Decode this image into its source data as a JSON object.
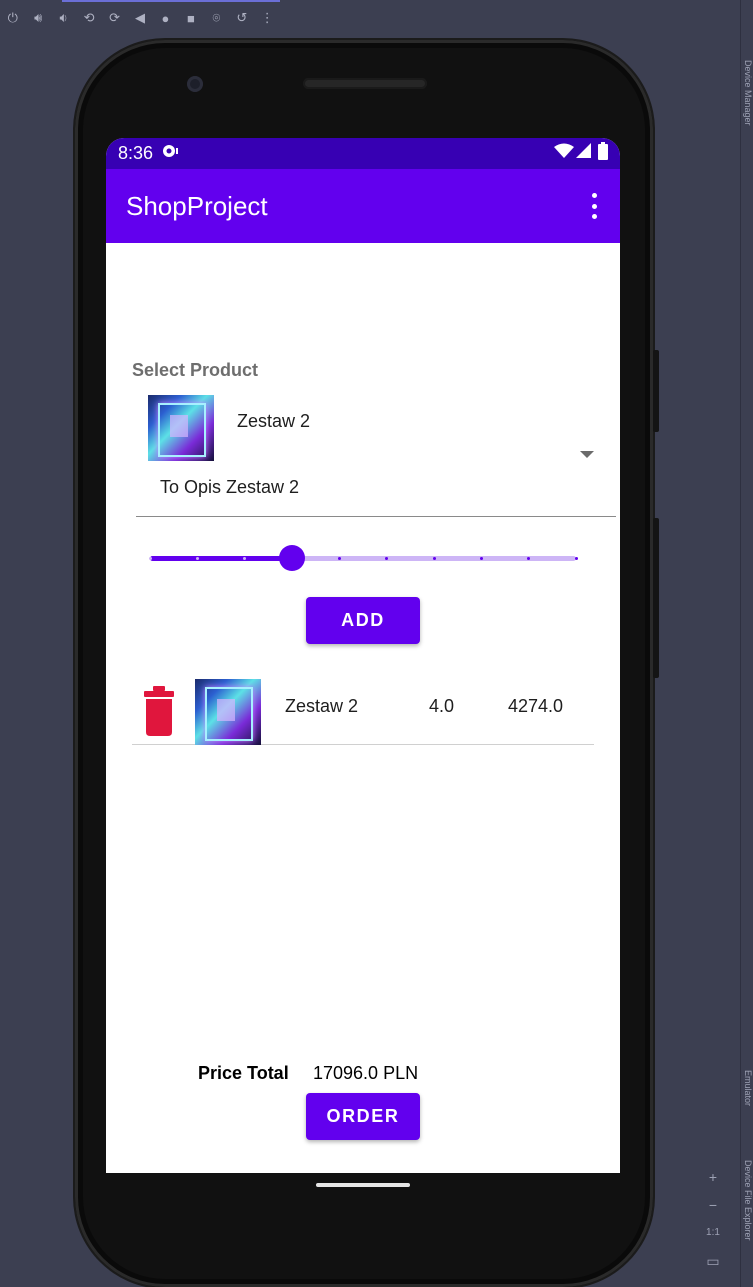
{
  "emulator": {
    "toolbar_icons": [
      "power-icon",
      "volume-up-icon",
      "volume-down-icon",
      "rotate-left-icon",
      "rotate-right-icon",
      "back-icon",
      "home-icon",
      "overview-icon",
      "camera-icon",
      "replay-icon",
      "more-icon"
    ],
    "zoom_controls": {
      "plus": "+",
      "minus": "−",
      "ratio": "1:1"
    },
    "side_panels": [
      "Device Manager",
      "Emulator",
      "Device File Explorer"
    ]
  },
  "status_bar": {
    "time": "8:36"
  },
  "app_bar": {
    "title": "ShopProject"
  },
  "product_select": {
    "label": "Select Product",
    "selected_name": "Zestaw 2",
    "selected_description": "To Opis Zestaw 2"
  },
  "quantity_slider": {
    "value": 4,
    "min": 1,
    "max": 10
  },
  "add_button": {
    "label": "ADD"
  },
  "cart": {
    "items": [
      {
        "name": "Zestaw 2",
        "quantity": "4.0",
        "price": "4274.0"
      }
    ]
  },
  "totals": {
    "label": "Price Total",
    "value": "17096.0 PLN"
  },
  "order_button": {
    "label": "ORDER"
  },
  "colors": {
    "primary": "#6200ee",
    "primary_dark": "#3700b3",
    "delete": "#e0163d",
    "emulator_bg": "#3c3f51"
  }
}
